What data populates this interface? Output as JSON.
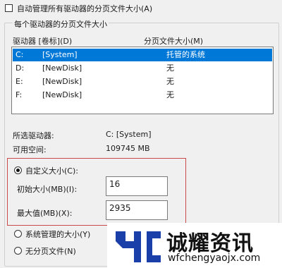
{
  "auto_manage_label": "自动管理所有驱动器的分页文件大小(A)",
  "group_title": "每个驱动器的分页文件大小",
  "list": {
    "col_drive": "驱动器 [卷标](D)",
    "col_size": "分页文件大小(M)",
    "rows": [
      {
        "drive": "C:",
        "label": "[System]",
        "size": "托管的系统",
        "selected": true
      },
      {
        "drive": "D:",
        "label": "[NewDisk]",
        "size": "无",
        "selected": false
      },
      {
        "drive": "E:",
        "label": "[NewDisk]",
        "size": "无",
        "selected": false
      },
      {
        "drive": "F:",
        "label": "[NewDisk]",
        "size": "无",
        "selected": false
      }
    ]
  },
  "selected_drive": {
    "label": "所选驱动器:",
    "value": "C:  [System]"
  },
  "free_space": {
    "label": "可用空间:",
    "value": "109745 MB"
  },
  "custom_size": {
    "label": "自定义大小(C):",
    "checked": true
  },
  "initial_size": {
    "label": "初始大小(MB)(I):",
    "value": "16"
  },
  "max_size": {
    "label": "最大值(MB)(X):",
    "value": "2935"
  },
  "system_managed": {
    "label": "系统管理的大小(Y)",
    "checked": false
  },
  "no_paging": {
    "label": "无分页文件(N)",
    "checked": false
  },
  "watermark": {
    "brand": "诚耀资讯",
    "url": "wfchengyaojx.com",
    "logo_color": "#1a3fa8"
  }
}
